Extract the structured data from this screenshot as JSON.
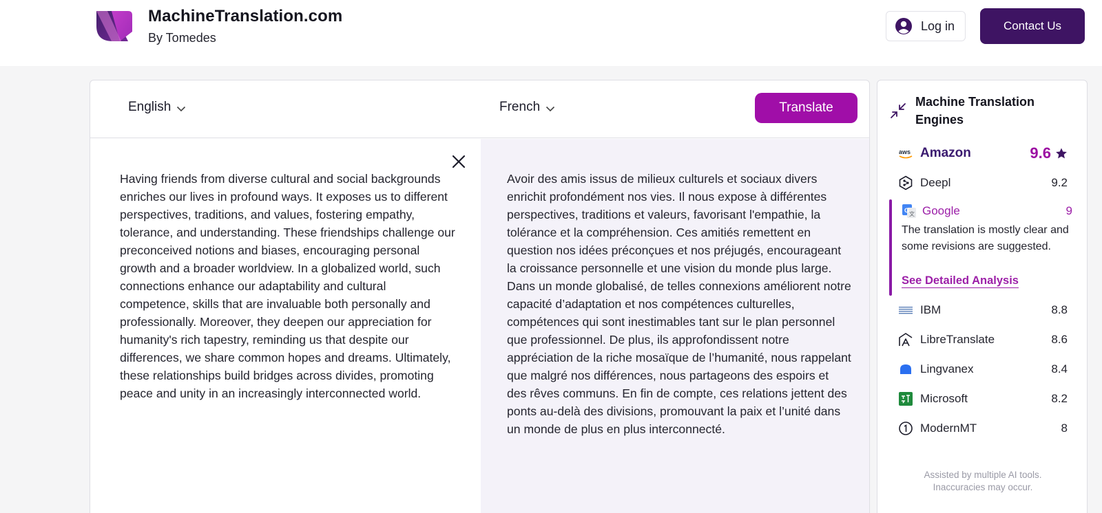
{
  "header": {
    "brand_title": "MachineTranslation.com",
    "brand_subtitle": "By Tomedes",
    "login_label": "Log in",
    "contact_label": "Contact Us",
    "logo_icon": "machinetranslation-logo",
    "login_icon": "user-circle-icon"
  },
  "translator": {
    "source_language": "English",
    "target_language": "French",
    "translate_label": "Translate",
    "source_text": "Having friends from diverse cultural and social backgrounds enriches our lives in profound ways. It exposes us to different perspectives, traditions, and values, fostering empathy, tolerance, and understanding. These friendships challenge our preconceived notions and biases, encouraging personal growth and a broader worldview. In a globalized world, such connections enhance our adaptability and cultural competence, skills that are invaluable both personally and professionally. Moreover, they deepen our appreciation for humanity's rich tapestry, reminding us that despite our differences, we share common hopes and dreams. Ultimately, these relationships build bridges across divides, promoting peace and unity in an increasingly interconnected world.",
    "target_text": "Avoir des amis issus de milieux culturels et sociaux divers enrichit profondément nos vies. Il nous expose à différentes perspectives, traditions et valeurs, favorisant l'empathie, la tolérance et la compréhension. Ces amitiés remettent en question nos idées préconçues et nos préjugés, encourageant la croissance personnelle et une vision du monde plus large. Dans un monde globalisé, de telles connexions améliorent notre capacité d’adaptation et nos compétences culturelles, compétences qui sont inestimables tant sur le plan personnel que professionnel. De plus, ils approfondissent notre appréciation de la riche mosaïque de l’humanité, nous rappelant que malgré nos différences, nous partageons des espoirs et des rêves communs. En fin de compte, ces relations jettent des ponts au-delà des divisions, promouvant la paix et l’unité dans un monde de plus en plus interconnecté."
  },
  "engines": {
    "title": "Machine Translation Engines",
    "top": {
      "name": "Amazon",
      "score": "9.6",
      "icon": "aws-icon"
    },
    "selected": {
      "name": "Google",
      "score": "9",
      "description": "The translation is mostly clear and some revisions are suggested.",
      "link_label": "See Detailed Analysis",
      "icon": "google-translate-icon"
    },
    "list": [
      {
        "name": "Deepl",
        "score": "9.2",
        "icon": "deepl-icon"
      },
      {
        "name": "IBM",
        "score": "8.8",
        "icon": "ibm-icon"
      },
      {
        "name": "LibreTranslate",
        "score": "8.6",
        "icon": "libretranslate-icon"
      },
      {
        "name": "Lingvanex",
        "score": "8.4",
        "icon": "lingvanex-icon"
      },
      {
        "name": "Microsoft",
        "score": "8.2",
        "icon": "microsoft-icon"
      },
      {
        "name": "ModernMT",
        "score": "8",
        "icon": "modernmt-icon"
      }
    ],
    "disclaimer": "Assisted by multiple AI tools. Inaccuracies may occur."
  },
  "colors": {
    "brand_dark": "#3e1463",
    "accent_magenta": "#a00ea8",
    "target_pane_bg": "#f4f2f9"
  }
}
